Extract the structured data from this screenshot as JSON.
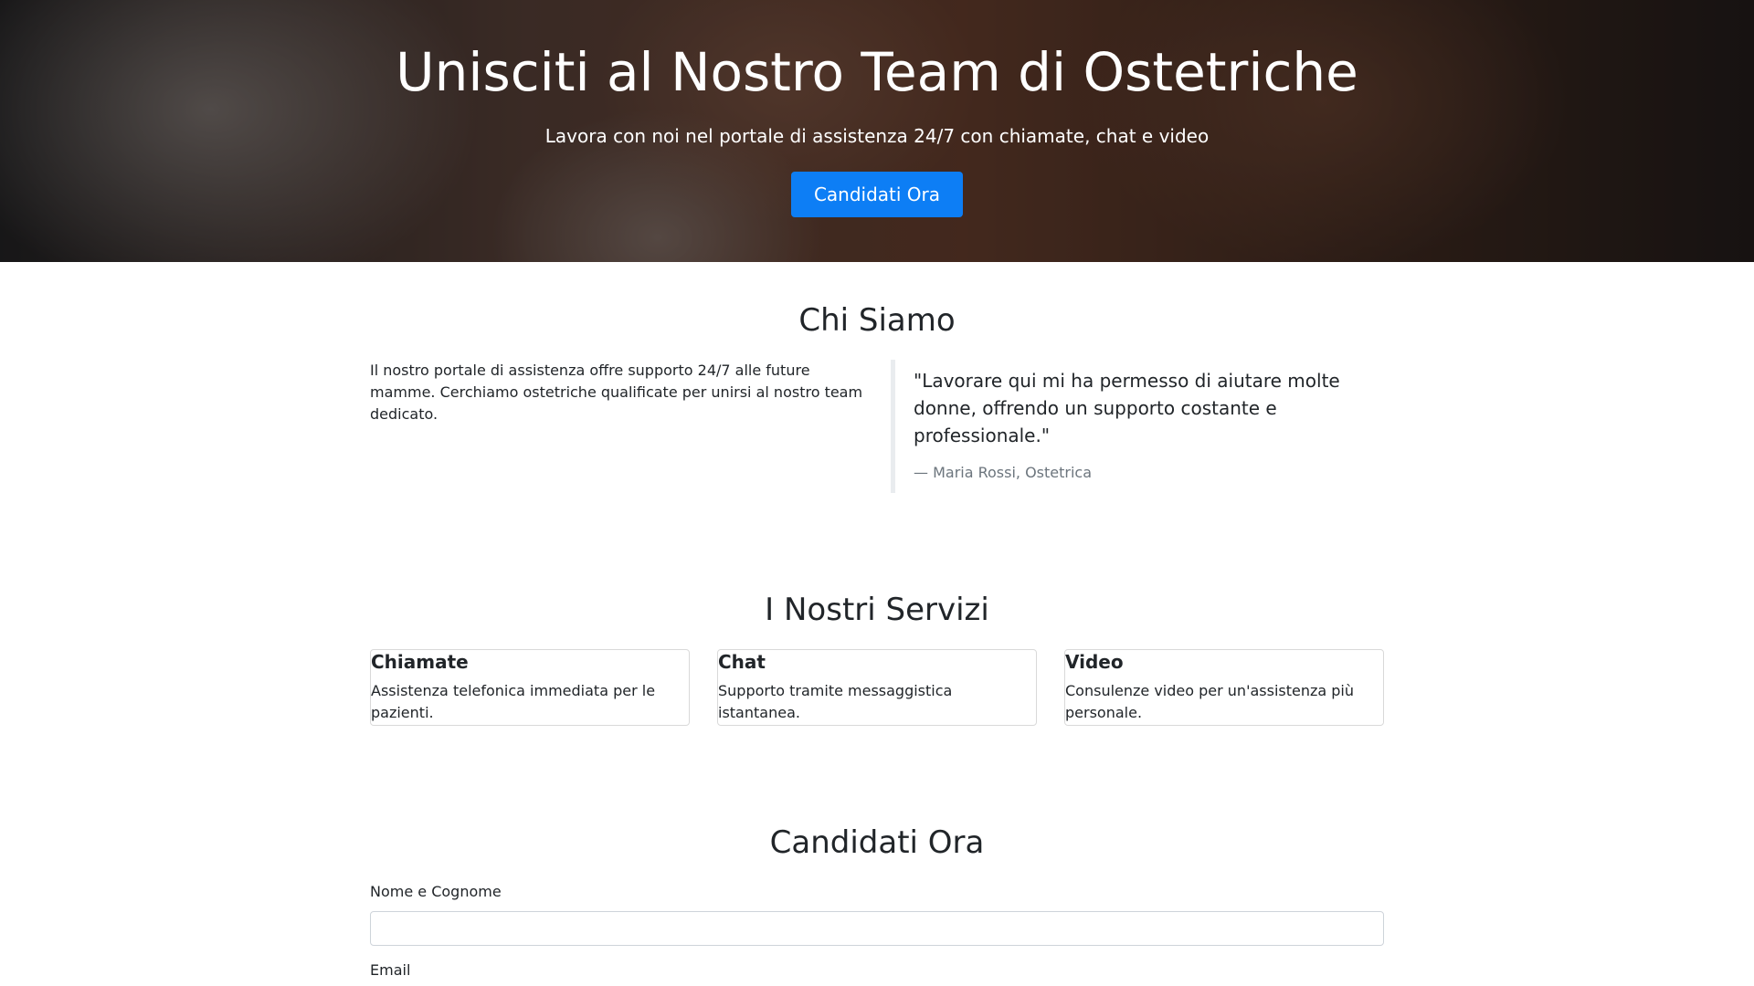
{
  "hero": {
    "title": "Unisciti al Nostro Team di Ostetriche",
    "subtitle": "Lavora con noi nel portale di assistenza 24/7 con chiamate, chat e video",
    "cta_label": "Candidati Ora"
  },
  "about": {
    "title": "Chi Siamo",
    "text": "Il nostro portale di assistenza offre supporto 24/7 alle future mamme. Cerchiamo ostetriche qualificate per unirsi al nostro team dedicato.",
    "quote": "\"Lavorare qui mi ha permesso di aiutare molte donne, offrendo un supporto costante e professionale.\"",
    "quote_author": "— Maria Rossi, Ostetrica"
  },
  "services": {
    "title": "I Nostri Servizi",
    "items": [
      {
        "title": "Chiamate",
        "text": "Assistenza telefonica immediata per le pazienti."
      },
      {
        "title": "Chat",
        "text": "Supporto tramite messaggistica istantanea."
      },
      {
        "title": "Video",
        "text": "Consulenze video per un'assistenza più personale."
      }
    ]
  },
  "application": {
    "title": "Candidati Ora",
    "name_label": "Nome e Cognome",
    "name_value": "",
    "email_label": "Email"
  }
}
